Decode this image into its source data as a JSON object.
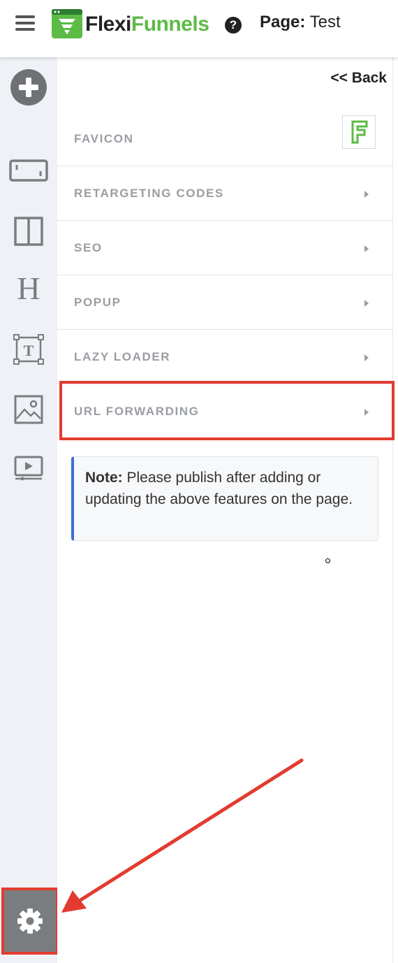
{
  "header": {
    "brand_part1": "Flexi",
    "brand_part2": "Funnels",
    "help_icon": "?",
    "page_label": "Page:",
    "page_name": "Test"
  },
  "toolbar": {
    "items": [
      "add-icon",
      "section-icon",
      "columns-icon",
      "heading-icon",
      "text-icon",
      "image-icon",
      "video-icon"
    ],
    "settings_icon": "gear-icon"
  },
  "panel": {
    "back": "<< Back",
    "favicon_label": "FAVICON",
    "rows": [
      {
        "label": "RETARGETING CODES"
      },
      {
        "label": "SEO"
      },
      {
        "label": "POPUP"
      },
      {
        "label": "LAZY LOADER"
      },
      {
        "label": "URL FORWARDING"
      }
    ],
    "note_bold": "Note:",
    "note_text": " Please publish after adding or updating the above features on the page."
  },
  "colors": {
    "accent_green": "#5cbb45",
    "highlight_red": "#e33b30",
    "note_border": "#3a6fd8"
  }
}
